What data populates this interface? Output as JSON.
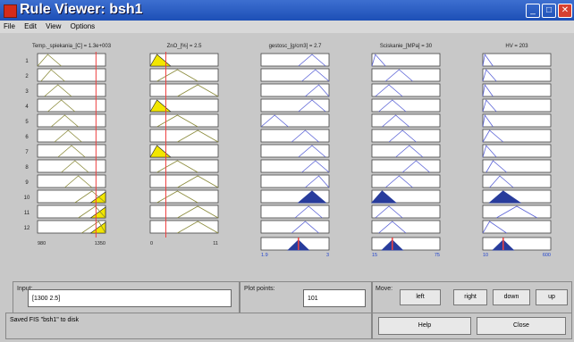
{
  "window": {
    "title": "Rule Viewer: bsh1"
  },
  "menu": {
    "items": [
      "File",
      "Edit",
      "View",
      "Options"
    ]
  },
  "inputs": [
    {
      "label": "Temp._spiekania_[C] = 1.3e+003",
      "range": [
        "980",
        "1350"
      ],
      "value_fraction": 0.86
    },
    {
      "label": "ZnO_[%] = 2.5",
      "range": [
        "0",
        "11"
      ],
      "value_fraction": 0.23
    }
  ],
  "outputs": [
    {
      "label": "gestosc_[g/cm3] = 2.7",
      "range": [
        "1.9",
        "3"
      ]
    },
    {
      "label": "Sciskanie_[MPa] = 30",
      "range": [
        "15",
        "75"
      ]
    },
    {
      "label": "HV = 203",
      "range": [
        "10",
        "600"
      ]
    }
  ],
  "rules": [
    "1",
    "2",
    "3",
    "4",
    "5",
    "6",
    "7",
    "8",
    "9",
    "10",
    "11",
    "12"
  ],
  "controls": {
    "input_label": "Input:",
    "input_value": "[1300 2.5]",
    "plot_points_label": "Plot points:",
    "plot_points_value": "101",
    "move_label": "Move:",
    "left": "left",
    "right": "right",
    "down": "down",
    "up": "up",
    "help": "Help",
    "close": "Close",
    "status": "Saved FIS \"bsh1\" to disk"
  },
  "colors": {
    "title_bar": "#2a5cc4",
    "fill_yellow": "#f2e600",
    "fill_blue": "#283c9c",
    "line_red": "#ee4040",
    "mf_olive": "#8a8a3a",
    "mf_blue": "#5a62d6"
  }
}
